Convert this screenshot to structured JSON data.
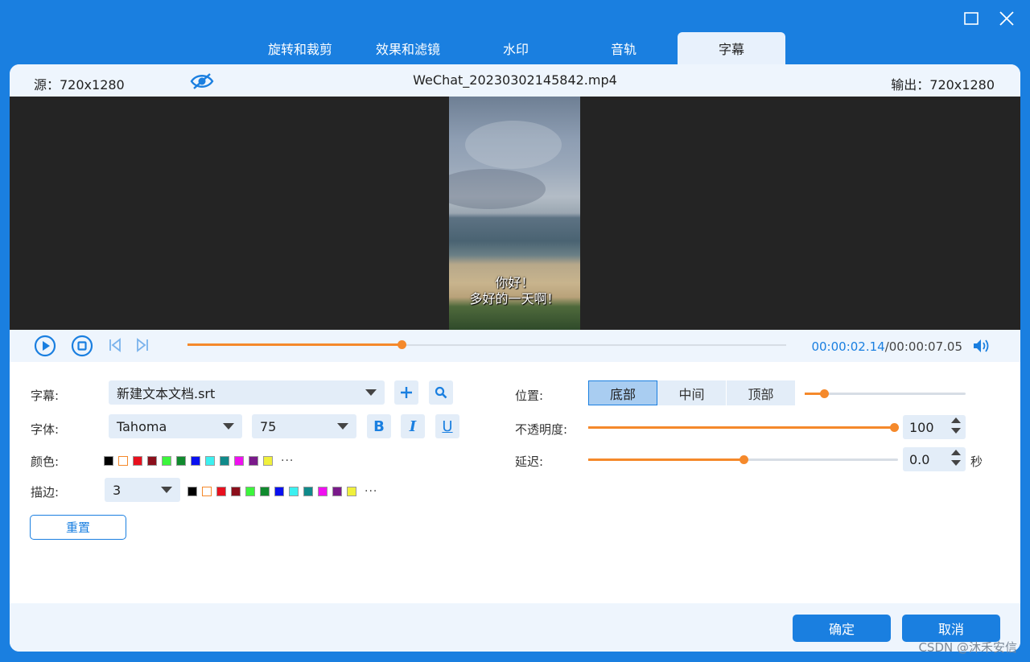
{
  "window": {
    "controls": [
      "maximize-icon",
      "close-icon"
    ]
  },
  "tabs": [
    {
      "label": "旋转和裁剪"
    },
    {
      "label": "效果和滤镜"
    },
    {
      "label": "水印"
    },
    {
      "label": "音轨"
    },
    {
      "label": "字幕",
      "active": true
    }
  ],
  "info": {
    "source": "源：720x1280",
    "file_name": "WeChat_20230302145842.mp4",
    "output": "输出：720x1280",
    "eye_icon": "eye-hidden-icon"
  },
  "preview": {
    "subtitle_line1": "你好！",
    "subtitle_line2": "多好的一天啊！"
  },
  "playback": {
    "current_time": "00:00:02.14",
    "separator": "/",
    "total_time": "00:00:07.05",
    "progress": 0.358,
    "icons": [
      "play-icon",
      "stop-icon",
      "prev-frame-icon",
      "next-frame-icon",
      "volume-icon"
    ]
  },
  "settings": {
    "subtitle_label": "字幕:",
    "subtitle_file": "新建文本文档.srt",
    "font_label": "字体:",
    "font_name": "Tahoma",
    "font_size": "75",
    "bold": "B",
    "italic": "I",
    "underline": "U",
    "color_label": "颜色:",
    "colors": [
      "#000000",
      "#ffffff",
      "#e8101e",
      "#8b0f1b",
      "#3cf53c",
      "#108a2e",
      "#0a10f0",
      "#3cf0f0",
      "#108a8a",
      "#f010f0",
      "#7a1a8a",
      "#f0f03c"
    ],
    "color_selected_border": "#f5892b",
    "more": "···",
    "outline_label": "描边:",
    "outline_width": "3",
    "outline_colors": [
      "#000000",
      "#ffffff",
      "#e8101e",
      "#8b0f1b",
      "#3cf53c",
      "#108a2e",
      "#0a10f0",
      "#3cf0f0",
      "#108a8a",
      "#f010f0",
      "#7a1a8a",
      "#f0f03c"
    ],
    "reset_label": "重置",
    "position_label": "位置:",
    "positions": [
      "底部",
      "中间",
      "顶部"
    ],
    "position_active": "底部",
    "position_offset": 0.12,
    "opacity_label": "不透明度:",
    "opacity_value": "100",
    "opacity_fraction": 1.0,
    "delay_label": "延迟:",
    "delay_value": "0.0",
    "delay_unit": "秒",
    "delay_fraction": 0.5
  },
  "footer": {
    "ok_label": "确定",
    "cancel_label": "取消",
    "watermark": "CSDN @沐禾安信"
  },
  "colors": {
    "accent": "#1a7fe0",
    "progress": "#f5892b"
  }
}
